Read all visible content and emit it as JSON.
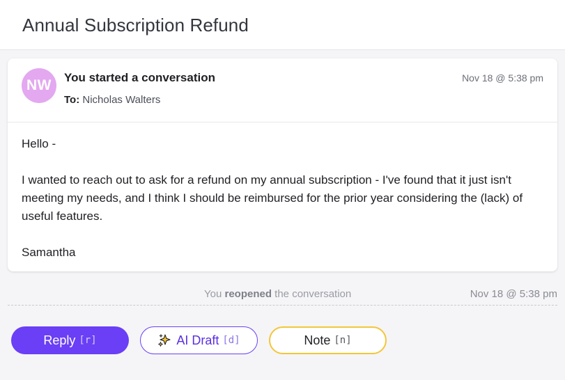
{
  "header": {
    "title": "Annual Subscription Refund"
  },
  "message": {
    "avatar_initials": "NW",
    "sender": "You started a conversation",
    "to_label": "To:",
    "to_name": "Nicholas Walters",
    "timestamp": "Nov 18 @ 5:38 pm",
    "body": {
      "greeting": "Hello -",
      "paragraph": "I wanted to reach out to ask for a refund on my annual subscription - I've found that it just isn't meeting my needs, and I think I should be reimbursed for the prior year considering the (lack) of useful features.",
      "signature": "Samantha"
    }
  },
  "event": {
    "actor": "You",
    "action": "reopened",
    "suffix": "the conversation",
    "timestamp": "Nov 18 @ 5:38 pm"
  },
  "actions": {
    "reply": {
      "label": "Reply",
      "shortcut": "[r]"
    },
    "ai_draft": {
      "label": "AI Draft",
      "shortcut": "[d]",
      "icon": "sparkle-icon"
    },
    "note": {
      "label": "Note",
      "shortcut": "[n]"
    }
  },
  "colors": {
    "accent": "#6a3ff5",
    "avatar_bg": "#e3a8f0",
    "note_border": "#f3c63a"
  }
}
